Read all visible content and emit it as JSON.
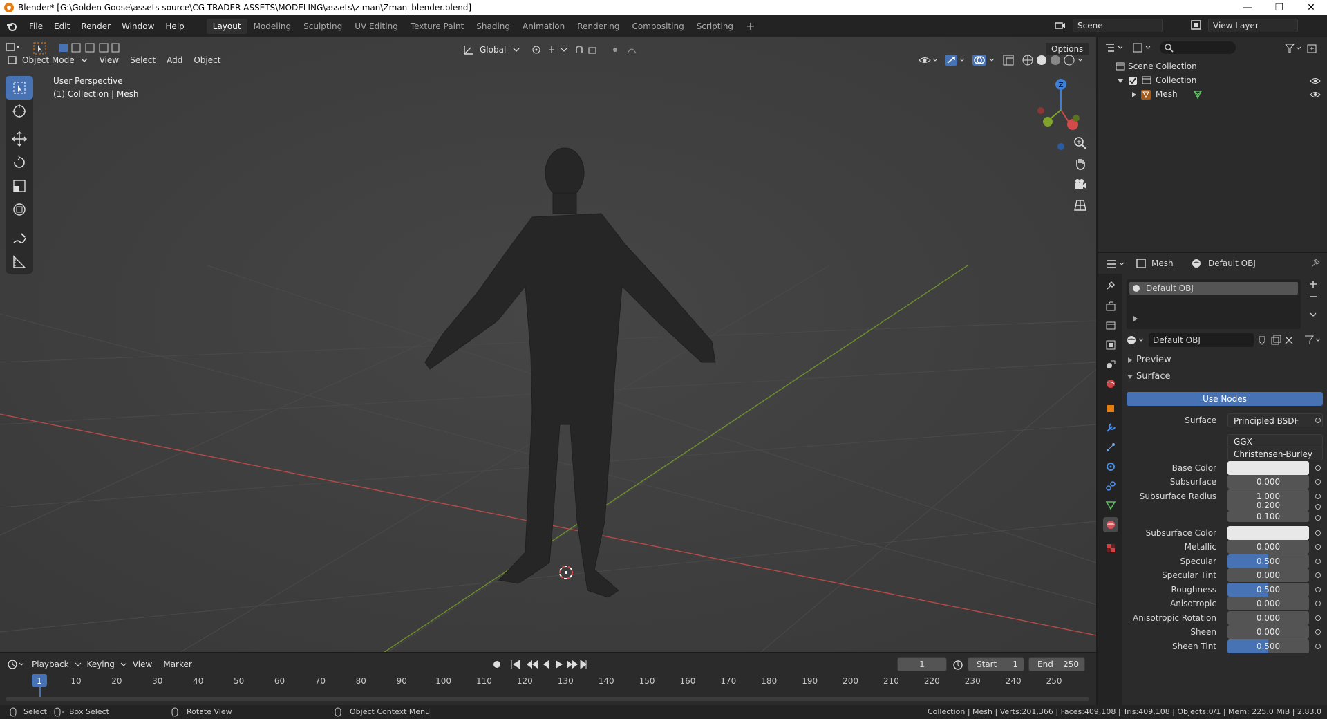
{
  "window": {
    "title": "Blender* [G:\\Golden Goose\\assets source\\CG TRADER ASSETS\\MODELING\\assets\\z man\\Zman_blender.blend]",
    "minimize": "—",
    "restore": "❐",
    "close": "✕"
  },
  "menu": [
    "File",
    "Edit",
    "Render",
    "Window",
    "Help"
  ],
  "workspaces": [
    "Layout",
    "Modeling",
    "Sculpting",
    "UV Editing",
    "Texture Paint",
    "Shading",
    "Animation",
    "Rendering",
    "Compositing",
    "Scripting"
  ],
  "active_workspace": "Layout",
  "scene": {
    "label": "Scene",
    "view_layer": "View Layer"
  },
  "viewport": {
    "mode": "Object Mode",
    "menus": [
      "View",
      "Select",
      "Add",
      "Object"
    ],
    "orientation": "Global",
    "options": "Options",
    "overlay_line1": "User Perspective",
    "overlay_line2": "(1) Collection | Mesh",
    "gizmo_z": "Z"
  },
  "outliner": {
    "root": "Scene Collection",
    "collection": "Collection",
    "object": "Mesh"
  },
  "properties": {
    "header_object": "Mesh",
    "header_material": "Default OBJ",
    "slot": "Default OBJ",
    "material_name": "Default OBJ",
    "preview_label": "Preview",
    "surface_section": "Surface",
    "use_nodes": "Use Nodes",
    "rows": [
      {
        "label": "Surface",
        "value": "Principled BSDF",
        "kind": "dd"
      },
      {
        "label": "",
        "value": "GGX",
        "kind": "dd"
      },
      {
        "label": "",
        "value": "Christensen-Burley",
        "kind": "dd"
      },
      {
        "label": "Base Color",
        "value": "",
        "kind": "white"
      },
      {
        "label": "Subsurface",
        "value": "0.000",
        "kind": "num"
      },
      {
        "label": "Subsurface Radius",
        "value": "1.000",
        "kind": "num"
      },
      {
        "label": "",
        "value": "0.200",
        "kind": "num"
      },
      {
        "label": "",
        "value": "0.100",
        "kind": "num"
      },
      {
        "label": "Subsurface Color",
        "value": "",
        "kind": "white"
      },
      {
        "label": "Metallic",
        "value": "0.000",
        "kind": "num"
      },
      {
        "label": "Specular",
        "value": "0.500",
        "kind": "blue"
      },
      {
        "label": "Specular Tint",
        "value": "0.000",
        "kind": "num"
      },
      {
        "label": "Roughness",
        "value": "0.500",
        "kind": "blue"
      },
      {
        "label": "Anisotropic",
        "value": "0.000",
        "kind": "num"
      },
      {
        "label": "Anisotropic Rotation",
        "value": "0.000",
        "kind": "num"
      },
      {
        "label": "Sheen",
        "value": "0.000",
        "kind": "num"
      },
      {
        "label": "Sheen Tint",
        "value": "0.500",
        "kind": "blue"
      }
    ]
  },
  "timeline": {
    "menus": [
      "Playback",
      "Keying",
      "View",
      "Marker"
    ],
    "current_frame": "1",
    "start_label": "Start",
    "start": "1",
    "end_label": "End",
    "end": "250",
    "ticks": [
      "1",
      "10",
      "20",
      "30",
      "40",
      "50",
      "60",
      "70",
      "80",
      "90",
      "100",
      "110",
      "120",
      "130",
      "140",
      "150",
      "160",
      "170",
      "180",
      "190",
      "200",
      "210",
      "220",
      "230",
      "240",
      "250"
    ]
  },
  "status": {
    "select": "Select",
    "box_select": "Box Select",
    "rotate": "Rotate View",
    "context": "Object Context Menu",
    "info": "Collection | Mesh | Verts:201,366 | Faces:409,108 | Tris:409,108 | Objects:0/1 | Mem: 225.0 MiB | 2.83.0"
  },
  "colors": {
    "accent": "#4772b3",
    "x_axis": "#d14b4b",
    "y_axis": "#7fa32b",
    "z_axis": "#3f7fd6",
    "orange": "#e87d0d"
  }
}
